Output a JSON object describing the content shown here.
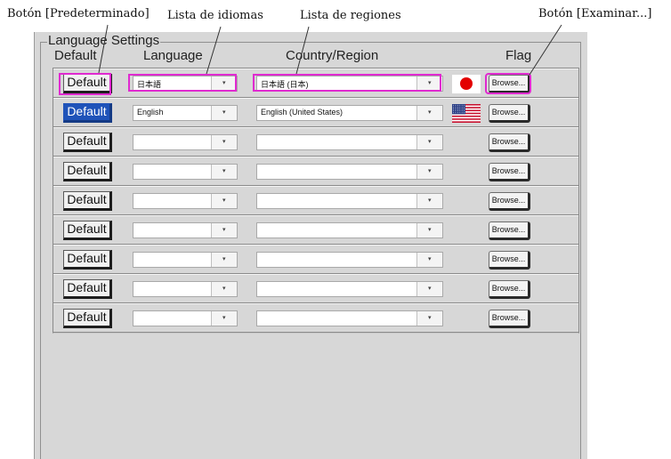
{
  "callouts": {
    "default_button": "Botón [Predeterminado]",
    "language_list": "Lista de idiomas",
    "region_list": "Lista de regiones",
    "browse_button": "Botón [Examinar...]"
  },
  "group_title": "Language Settings",
  "columns": {
    "default": "Default",
    "language": "Language",
    "country": "Country/Region",
    "flag": "Flag"
  },
  "rows": [
    {
      "default_label": "Default",
      "selected": false,
      "language": "日本語",
      "region": "日本語 (日本)",
      "flag": "jp",
      "browse_label": "Browse..."
    },
    {
      "default_label": "Default",
      "selected": true,
      "language": "English",
      "region": "English (United States)",
      "flag": "us",
      "browse_label": "Browse..."
    },
    {
      "default_label": "Default",
      "selected": false,
      "language": "",
      "region": "",
      "flag": "",
      "browse_label": "Browse..."
    },
    {
      "default_label": "Default",
      "selected": false,
      "language": "",
      "region": "",
      "flag": "",
      "browse_label": "Browse..."
    },
    {
      "default_label": "Default",
      "selected": false,
      "language": "",
      "region": "",
      "flag": "",
      "browse_label": "Browse..."
    },
    {
      "default_label": "Default",
      "selected": false,
      "language": "",
      "region": "",
      "flag": "",
      "browse_label": "Browse..."
    },
    {
      "default_label": "Default",
      "selected": false,
      "language": "",
      "region": "",
      "flag": "",
      "browse_label": "Browse..."
    },
    {
      "default_label": "Default",
      "selected": false,
      "language": "",
      "region": "",
      "flag": "",
      "browse_label": "Browse..."
    },
    {
      "default_label": "Default",
      "selected": false,
      "language": "",
      "region": "",
      "flag": "",
      "browse_label": "Browse..."
    }
  ],
  "icons": {
    "dropdown": "chevron-down-icon",
    "flag_jp": "japan-flag-icon",
    "flag_us": "usa-flag-icon"
  },
  "colors": {
    "highlight": "#e02ad0",
    "selected": "#1f53b9",
    "panel": "#d7d7d7"
  }
}
